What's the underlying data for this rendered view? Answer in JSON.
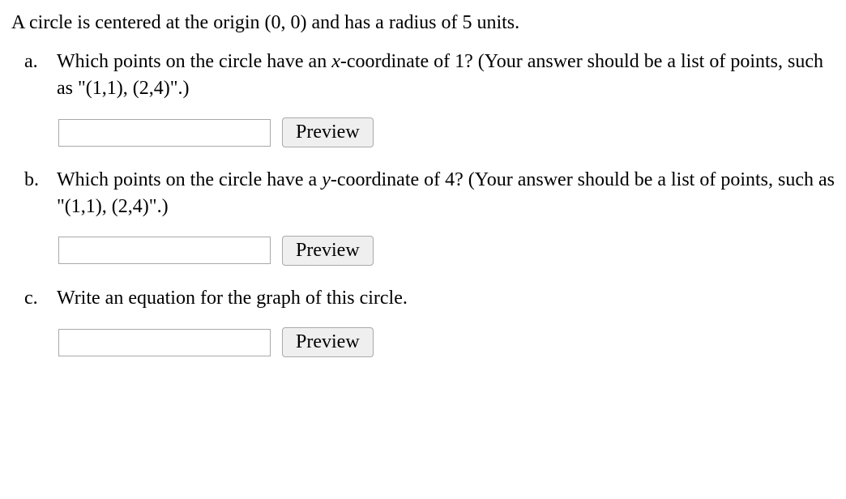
{
  "intro": "A circle is centered at the origin (0, 0) and has a radius of 5 units.",
  "parts": {
    "a": {
      "marker": "a.",
      "text_before": "Which points on the circle have an ",
      "var": "x",
      "text_after": "-coordinate of 1? (Your answer should be a list of points, such as \"(1,1), (2,4)\".)",
      "input_value": "",
      "preview_label": "Preview"
    },
    "b": {
      "marker": "b.",
      "text_before": "Which points on the circle have a ",
      "var": "y",
      "text_after": "-coordinate of 4? (Your answer should be a list of points, such as \"(1,1), (2,4)\".)",
      "input_value": "",
      "preview_label": "Preview"
    },
    "c": {
      "marker": "c.",
      "text": "Write an equation for the graph of this circle.",
      "input_value": "",
      "preview_label": "Preview"
    }
  }
}
